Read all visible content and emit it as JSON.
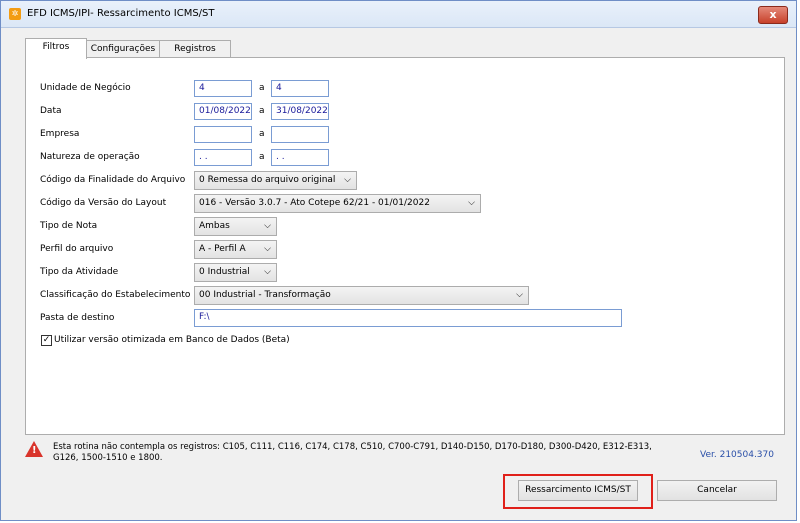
{
  "window": {
    "title": "EFD ICMS/IPI- Ressarcimento ICMS/ST",
    "close": "x"
  },
  "tabs": [
    "Filtros",
    "Configurações",
    "Registros"
  ],
  "form": {
    "unidade": {
      "label": "Unidade de Negócio",
      "from": "4",
      "sep": "a",
      "to": "4"
    },
    "data": {
      "label": "Data",
      "from": "01/08/2022",
      "sep": "a",
      "to": "31/08/2022"
    },
    "empresa": {
      "label": "Empresa",
      "from": "",
      "sep": "a",
      "to": ""
    },
    "natureza": {
      "label": "Natureza de operação",
      "from": ". .",
      "sep": "a",
      "to": ". ."
    },
    "finalidade": {
      "label": "Código da Finalidade do Arquivo",
      "value": "0 Remessa do arquivo original"
    },
    "versao": {
      "label": "Código da Versão do Layout",
      "value": "016 - Versão 3.0.7 - Ato Cotepe 62/21 - 01/01/2022"
    },
    "tipo_nota": {
      "label": "Tipo de Nota",
      "value": "Ambas"
    },
    "perfil": {
      "label": "Perfil do arquivo",
      "value": "A - Perfil A"
    },
    "atividade": {
      "label": "Tipo da Atividade",
      "value": "0 Industrial"
    },
    "classificacao": {
      "label": "Classificação do Estabelecimento",
      "value": "00 Industrial - Transformação"
    },
    "pasta": {
      "label": "Pasta de destino",
      "value": "F:\\"
    },
    "otimizada": {
      "label": "Utilizar versão otimizada em Banco de Dados (Beta)",
      "checked": true,
      "mark": "✓"
    }
  },
  "warning": {
    "line1": "Esta rotina não contempla os registros: C105, C111, C116, C174, C178, C510, C700-C791, D140-D150, D170-D180, D300-D420, E312-E313,",
    "line2": "G126, 1500-1510 e 1800.",
    "mark": "!"
  },
  "version": "Ver. 210504.370",
  "buttons": {
    "ressarcimento": "Ressarcimento ICMS/ST",
    "cancelar": "Cancelar"
  },
  "colors": {
    "highlight": "#e0201a",
    "field_text": "#1a1a9a",
    "version": "#2a4fa8"
  }
}
